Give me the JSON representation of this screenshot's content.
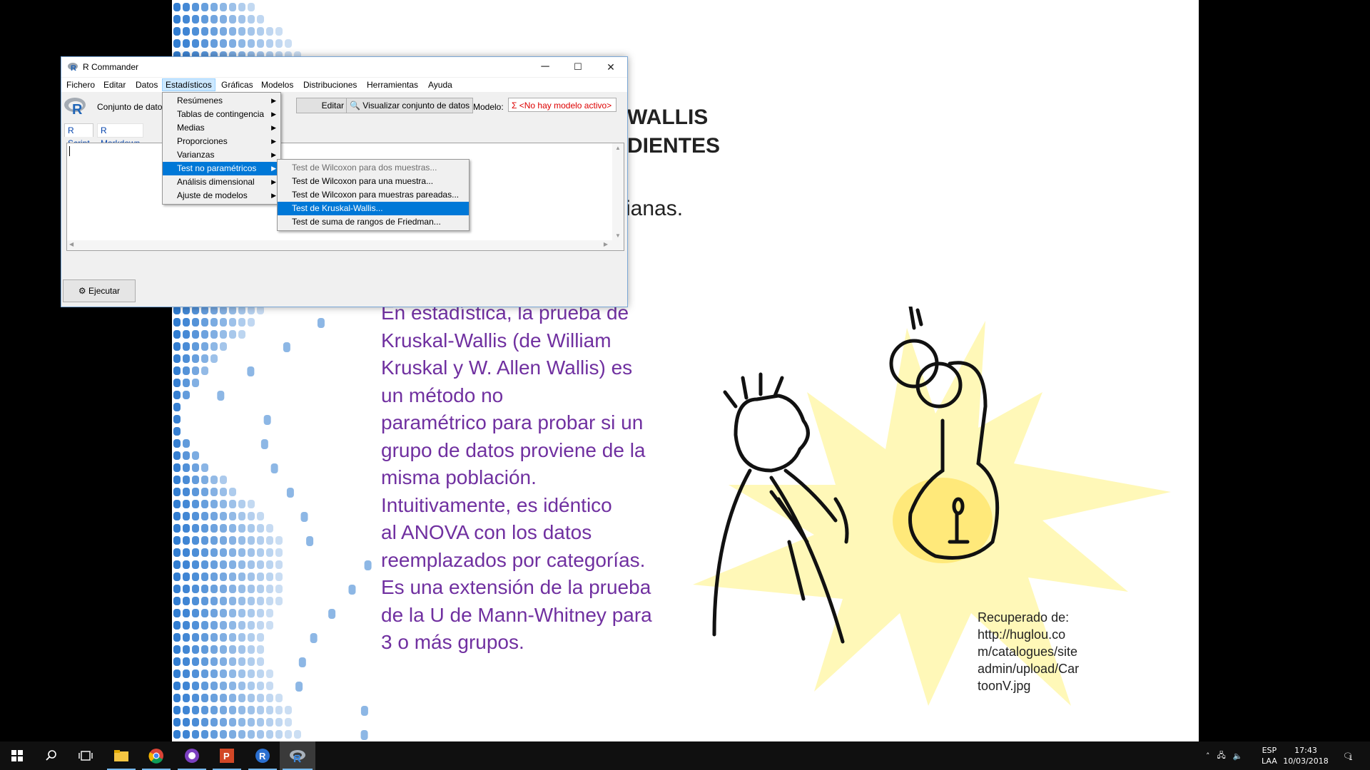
{
  "slide": {
    "heading_line1": "WALLIS",
    "heading_line2": "DIENTES",
    "heading_fragment": "ianas.",
    "body_lines": [
      "En estadística, la prueba de",
      "Kruskal-Wallis (de William",
      "Kruskal y W. Allen Wallis) es",
      "un método no",
      "paramétrico para probar si un",
      "grupo de datos proviene de la",
      "misma población.",
      "Intuitivamente, es idéntico",
      "al ANOVA con los datos",
      "reemplazados por categorías.",
      "Es una extensión de la prueba",
      "de la U de Mann-Whitney para",
      "3 o más grupos."
    ],
    "caption_lines": [
      "Recuperado de:",
      "http://huglou.co",
      "m/catalogues/site",
      "admin/upload/Car",
      "toonV.jpg"
    ]
  },
  "window": {
    "title": "R Commander",
    "controls": {
      "minimize": "─",
      "maximize": "☐",
      "close": "✕"
    },
    "menu": [
      "Fichero",
      "Editar",
      "Datos",
      "Estadísticos",
      "Gráficas",
      "Modelos",
      "Distribuciones",
      "Herramientas",
      "Ayuda"
    ],
    "toolbar": {
      "dataset_label": "Conjunto de datos:",
      "edit_dataset": "Editar conjunto de datos",
      "view_dataset": "Visualizar conjunto de datos",
      "model_label": "Modelo:",
      "model_value": "Σ <No hay modelo activo>"
    },
    "tabs": [
      "R Script",
      "R Markdown"
    ],
    "execute_label": "Ejecutar"
  },
  "stats_menu": [
    {
      "label": "Resúmenes",
      "submenu": true
    },
    {
      "label": "Tablas de contingencia",
      "submenu": true
    },
    {
      "label": "Medias",
      "submenu": true
    },
    {
      "label": "Proporciones",
      "submenu": true
    },
    {
      "label": "Varianzas",
      "submenu": true
    },
    {
      "label": "Test no paramétricos",
      "submenu": true,
      "highlighted": true
    },
    {
      "label": "Análisis dimensional",
      "submenu": true
    },
    {
      "label": "Ajuste de modelos",
      "submenu": true
    }
  ],
  "nonparam_menu": [
    {
      "label": "Test de Wilcoxon para dos muestras...",
      "disabled": true
    },
    {
      "label": "Test de Wilcoxon para una muestra..."
    },
    {
      "label": "Test de Wilcoxon para muestras pareadas..."
    },
    {
      "label": "Test de Kruskal-Wallis...",
      "highlighted": true
    },
    {
      "label": "Test de suma de rangos de Friedman..."
    }
  ],
  "taskbar": {
    "apps": [
      "start-icon",
      "search-icon",
      "task-view-icon",
      "file-explorer-icon",
      "chrome-icon",
      "app-icon",
      "powerpoint-icon",
      "r-icon",
      "rcmdr-icon"
    ],
    "language_top": "ESP",
    "language_bottom": "LAA",
    "time": "17:43",
    "date": "10/03/2018",
    "notifications": "1"
  },
  "colors": {
    "body_text": "#7030a0",
    "menu_highlight": "#0078d7",
    "dots": "#2f7bd0",
    "starburst": "#fff6b0"
  }
}
